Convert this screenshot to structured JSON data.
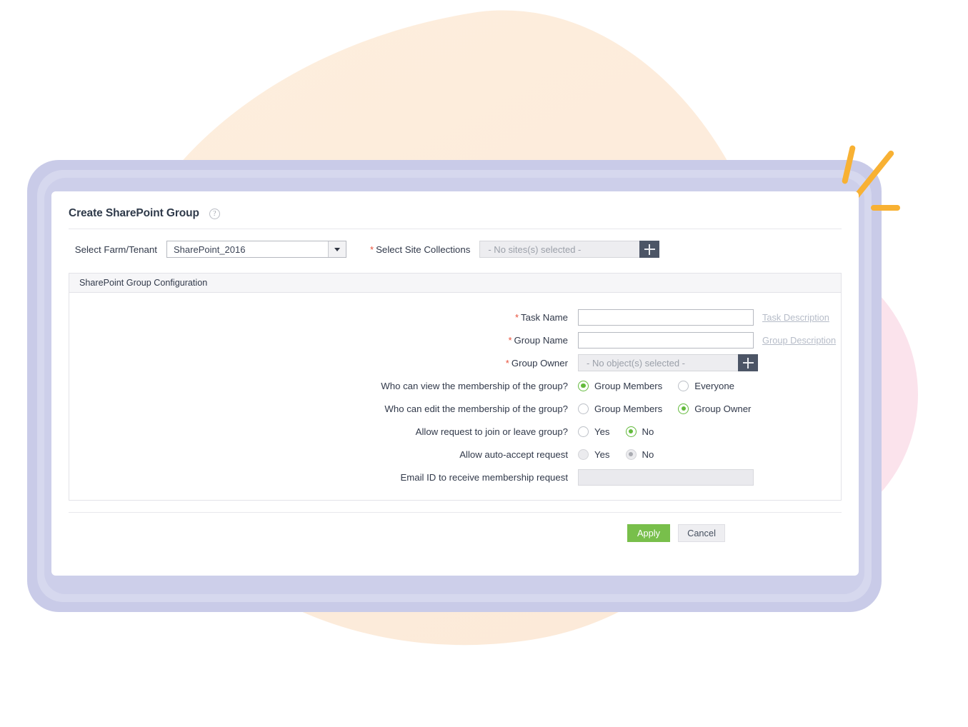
{
  "theme": {
    "accent_green": "#78bf4b",
    "radio_green": "#63ba3c",
    "required_red": "#e8503a",
    "plus_button": "#4c5566",
    "lavender_frame": "#c9cbe8",
    "blob_peach": "#fdecdc",
    "blob_pink": "#fbe3ec",
    "spark_yellow": "#f8b133"
  },
  "card": {
    "title": "Create SharePoint Group",
    "help_icon": "question-circle-icon"
  },
  "top_row": {
    "farm_label": "Select Farm/Tenant",
    "farm_value": "SharePoint_2016",
    "farm_options": [
      "SharePoint_2016"
    ],
    "farm_chevron_icon": "chevron-down-icon",
    "sites_required": "*",
    "sites_label": "Select Site Collections",
    "sites_value": "- No sites(s) selected -",
    "sites_add_icon": "plus-icon"
  },
  "panel": {
    "header": "SharePoint Group Configuration",
    "fields": {
      "task_name": {
        "required": "*",
        "label": "Task Name",
        "value": "",
        "placeholder": "",
        "side_link": "Task Description"
      },
      "group_name": {
        "required": "*",
        "label": "Group Name",
        "value": "",
        "placeholder": "",
        "side_link": "Group Description"
      },
      "group_owner": {
        "required": "*",
        "label": "Group Owner",
        "value": "- No object(s) selected -",
        "add_icon": "plus-icon"
      },
      "view_membership": {
        "label": "Who can view the membership of the group?",
        "options": [
          {
            "label": "Group Members",
            "selected": true
          },
          {
            "label": "Everyone",
            "selected": false
          }
        ]
      },
      "edit_membership": {
        "label": "Who can edit the membership of the group?",
        "options": [
          {
            "label": "Group Members",
            "selected": false
          },
          {
            "label": "Group Owner",
            "selected": true
          }
        ]
      },
      "allow_request": {
        "label": "Allow request to join or leave group?",
        "options": [
          {
            "label": "Yes",
            "selected": false
          },
          {
            "label": "No",
            "selected": true
          }
        ]
      },
      "auto_accept": {
        "label": "Allow auto-accept request",
        "disabled": true,
        "options": [
          {
            "label": "Yes",
            "selected": false
          },
          {
            "label": "No",
            "selected": true
          }
        ]
      },
      "email_id": {
        "label": "Email ID to receive membership request",
        "value": "",
        "placeholder": "",
        "disabled": true
      }
    }
  },
  "footer": {
    "apply_label": "Apply",
    "cancel_label": "Cancel"
  }
}
